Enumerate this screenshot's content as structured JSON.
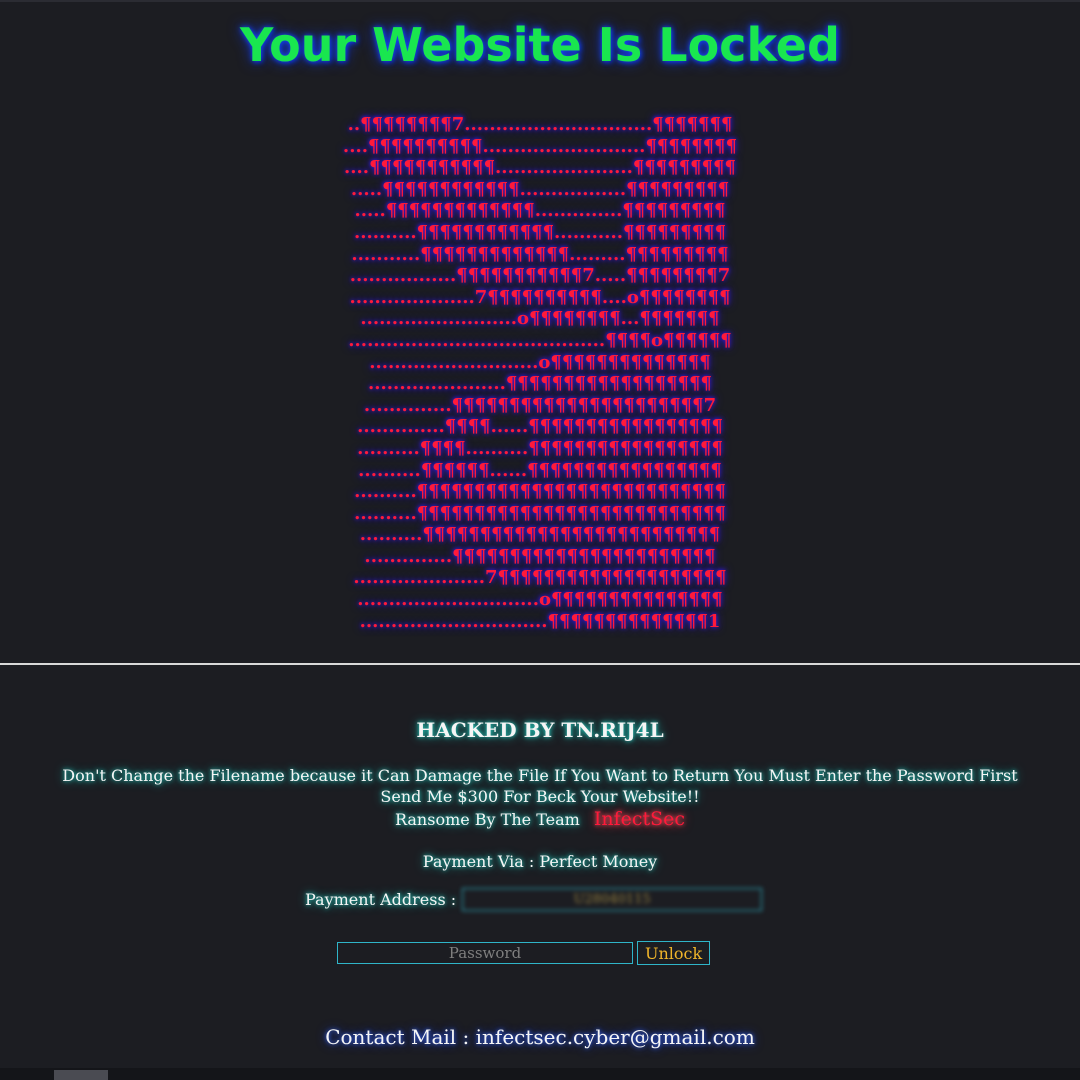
{
  "page": {
    "title": "Your Website Is Locked",
    "ascii_art": [
      "..¶¶¶¶¶¶¶¶7..............................¶¶¶¶¶¶¶",
      "....¶¶¶¶¶¶¶¶¶¶..........................¶¶¶¶¶¶¶¶",
      "....¶¶¶¶¶¶¶¶¶¶¶......................¶¶¶¶¶¶¶¶¶",
      ".....¶¶¶¶¶¶¶¶¶¶¶¶.................¶¶¶¶¶¶¶¶¶",
      ".....¶¶¶¶¶¶¶¶¶¶¶¶¶..............¶¶¶¶¶¶¶¶¶",
      "..........¶¶¶¶¶¶¶¶¶¶¶¶...........¶¶¶¶¶¶¶¶¶",
      "...........¶¶¶¶¶¶¶¶¶¶¶¶¶.........¶¶¶¶¶¶¶¶¶",
      ".................¶¶¶¶¶¶¶¶¶¶¶7.....¶¶¶¶¶¶¶¶7",
      "....................7¶¶¶¶¶¶¶¶¶¶....o¶¶¶¶¶¶¶¶",
      ".........................o¶¶¶¶¶¶¶¶...¶¶¶¶¶¶¶",
      ".........................................¶¶¶¶o¶¶¶¶¶¶",
      "...........................o¶¶¶¶¶¶¶¶¶¶¶¶¶¶",
      "......................¶¶¶¶¶¶¶¶¶¶¶¶¶¶¶¶¶¶",
      "..............¶¶¶¶¶¶¶¶¶¶¶¶¶¶¶¶¶¶¶¶¶¶7",
      "..............¶¶¶¶......¶¶¶¶¶¶¶¶¶¶¶¶¶¶¶¶¶",
      "..........¶¶¶¶..........¶¶¶¶¶¶¶¶¶¶¶¶¶¶¶¶¶",
      "..........¶¶¶¶¶¶......¶¶¶¶¶¶¶¶¶¶¶¶¶¶¶¶¶",
      "..........¶¶¶¶¶¶¶¶¶¶¶¶¶¶¶¶¶¶¶¶¶¶¶¶¶¶¶",
      "..........¶¶¶¶¶¶¶¶¶¶¶¶¶¶¶¶¶¶¶¶¶¶¶¶¶¶¶",
      "..........¶¶¶¶¶¶¶¶¶¶¶¶¶¶¶¶¶¶¶¶¶¶¶¶¶¶",
      "..............¶¶¶¶¶¶¶¶¶¶¶¶¶¶¶¶¶¶¶¶¶¶¶",
      ".....................7¶¶¶¶¶¶¶¶¶¶¶¶¶¶¶¶¶¶¶¶",
      ".............................o¶¶¶¶¶¶¶¶¶¶¶¶¶¶¶",
      "..............................¶¶¶¶¶¶¶¶¶¶¶¶¶¶1"
    ],
    "hacked_by": "HACKED BY TN.RIJ4L",
    "message_line1": "Don't Change the Filename because it Can Damage the File If You Want to Return You Must Enter the Password First",
    "message_line2": "Send Me $300 For Beck Your Website!!",
    "ransom_label": "Ransome By The Team",
    "team_name": "InfectSec",
    "payment_via": "Payment Via : Perfect Money",
    "payment_address_label": "Payment Address :",
    "payment_address_value": "U28040115",
    "password_placeholder": "Password",
    "unlock_label": "Unlock",
    "contact": "Contact Mail : infectsec.cyber@gmail.com"
  },
  "colors": {
    "background": "#1c1d22",
    "title": "#19e64f",
    "art": "#ff1a3a",
    "accent_border": "#2fb5c9",
    "unlock_text": "#f0b52a"
  }
}
